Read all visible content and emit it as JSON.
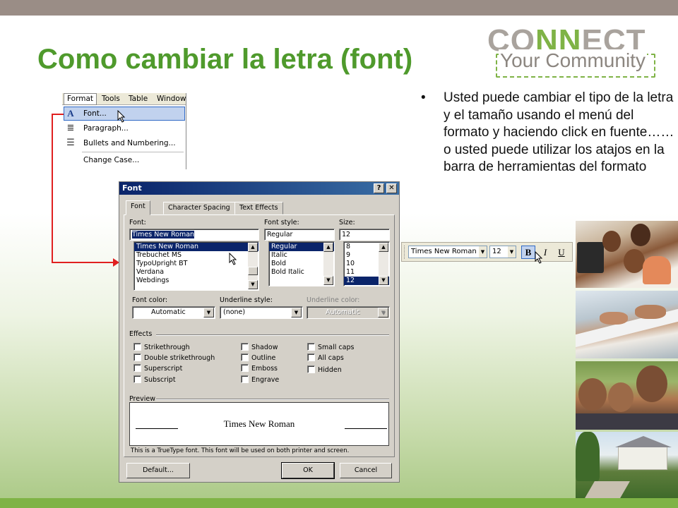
{
  "slide": {
    "title": "Como cambiar la letra (font)",
    "bullet": "Usted puede cambiar el tipo de la letra y el tamaño usando el menú del formato y haciendo click en fuente…… o usted puede utilizar los atajos en la barra de herramientas del formato",
    "bullet_marker": "•"
  },
  "logo": {
    "top_a": "CO",
    "top_b": "NN",
    "top_c": "ECT",
    "sub": "Your Community"
  },
  "format_menu": {
    "menubar": [
      "Format",
      "Tools",
      "Table",
      "Window"
    ],
    "items": [
      {
        "label": "Font...",
        "icon": "font-a-icon"
      },
      {
        "label": "Paragraph...",
        "icon": "paragraph-icon"
      },
      {
        "label": "Bullets and Numbering...",
        "icon": "bullets-icon"
      },
      {
        "label": "Change Case..."
      }
    ]
  },
  "font_dialog": {
    "title": "Font",
    "help_btn": "?",
    "close_btn": "✕",
    "tabs": [
      "Font",
      "Character Spacing",
      "Text Effects"
    ],
    "font_label": "Font:",
    "font_value": "Times New Roman",
    "font_list": [
      "Times New Roman",
      "Trebuchet MS",
      "TypoUpright BT",
      "Verdana",
      "Webdings"
    ],
    "style_label": "Font style:",
    "style_value": "Regular",
    "style_list": [
      "Regular",
      "Italic",
      "Bold",
      "Bold Italic"
    ],
    "size_label": "Size:",
    "size_value": "12",
    "size_list": [
      "8",
      "9",
      "10",
      "11",
      "12"
    ],
    "font_color_label": "Font color:",
    "font_color_value": "Automatic",
    "underline_style_label": "Underline style:",
    "underline_style_value": "(none)",
    "underline_color_label": "Underline color:",
    "underline_color_value": "Automatic",
    "effects_label": "Effects",
    "effects_col1": [
      "Strikethrough",
      "Double strikethrough",
      "Superscript",
      "Subscript"
    ],
    "effects_col2": [
      "Shadow",
      "Outline",
      "Emboss",
      "Engrave"
    ],
    "effects_col3": [
      "Small caps",
      "All caps",
      "Hidden"
    ],
    "preview_label": "Preview",
    "preview_text": "Times New Roman",
    "truetype_note": "This is a TrueType font. This font will be used on both printer and screen.",
    "default_btn": "Default...",
    "ok_btn": "OK",
    "cancel_btn": "Cancel"
  },
  "toolbar": {
    "font_value": "Times New Roman",
    "size_value": "12",
    "bold": "B",
    "italic": "I",
    "underline": "U"
  },
  "colors": {
    "title_green": "#4f9a2c",
    "accent_green": "#7fb346",
    "top_bar": "#9a8d86",
    "connector_red": "#e02020"
  }
}
